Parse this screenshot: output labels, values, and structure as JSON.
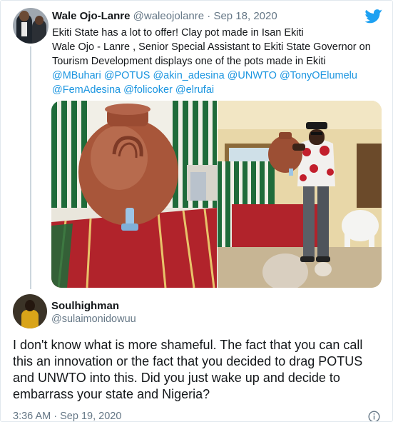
{
  "quoted_tweet": {
    "name": "Wale Ojo-Lanre",
    "handle": "@waleojolanre",
    "separator": "·",
    "date": "Sep 18, 2020",
    "text_lines": [
      "Ekiti State has a lot to offer! Clay pot made in Isan Ekiti",
      "Wale Ojo - Lanre , Senior Special Assistant to Ekiti State Governor on",
      "Tourism Development displays one of the pots made in Ekiti"
    ],
    "mentions": [
      "@MBuhari",
      "@POTUS",
      "@akin_adesina",
      "@UNWTO",
      "@TonyOElumelu",
      "@FemAdesina",
      "@folicoker",
      "@elrufai"
    ]
  },
  "reply_tweet": {
    "name": "Soulhighman",
    "handle": "@sulaimonidowuu",
    "text_lines": [
      "I don't know what is more shameful. The fact that you can call",
      "this an innovation or the fact that you decided to drag POTUS",
      "and UNWTO into this. Did you just wake up and decide to",
      "embarrass your state and Nigeria?"
    ],
    "time": "3:36 AM",
    "separator": "·",
    "date": "Sep 19, 2020"
  },
  "icons": {
    "brand": "twitter-bird-icon",
    "info": "info-icon"
  },
  "colors": {
    "brand": "#1da1f2",
    "mention": "#1b95e0",
    "secondary_text": "#657786",
    "primary_text": "#14171a"
  }
}
